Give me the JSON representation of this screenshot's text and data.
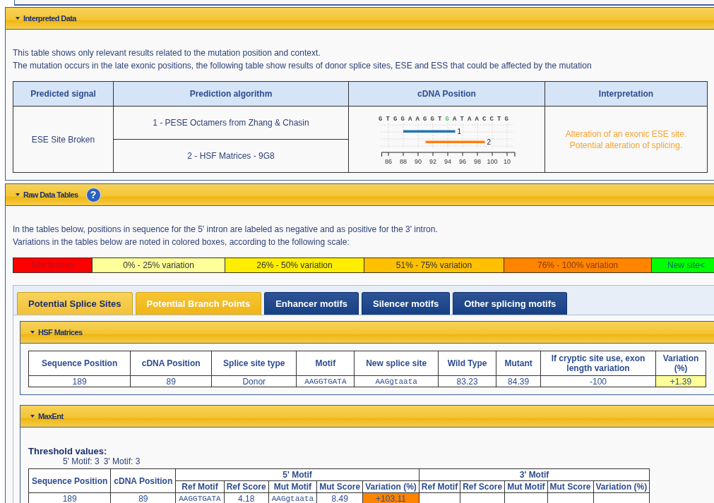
{
  "interpreted": {
    "title": "Interpreted Data",
    "intro": [
      "This table shows only relevant results related to the mutation position and context.",
      "The mutation occurs in the late exonic positions, the following table show results of donor splice sites, ESE and ESS that could be affected by the mutation"
    ],
    "columns": [
      "Predicted signal",
      "Prediction algorithm",
      "cDNA Position",
      "Interpretation"
    ],
    "rows": [
      {
        "signal": "ESE Site Broken",
        "algorithms": [
          "1 - PESE Octamers from Zhang & Chasin",
          "2 - HSF Matrices - 9G8"
        ],
        "sequence": [
          {
            "base": "G",
            "mutated": false
          },
          {
            "base": "T",
            "mutated": false
          },
          {
            "base": "G",
            "mutated": false
          },
          {
            "base": "G",
            "mutated": false
          },
          {
            "base": "A",
            "mutated": false
          },
          {
            "base": "A",
            "mutated": false
          },
          {
            "base": "G",
            "mutated": false
          },
          {
            "base": "G",
            "mutated": false
          },
          {
            "base": "T",
            "mutated": false
          },
          {
            "base": "G",
            "mutated": true
          },
          {
            "base": "A",
            "mutated": false
          },
          {
            "base": "T",
            "mutated": false
          },
          {
            "base": "A",
            "mutated": false
          },
          {
            "base": "A",
            "mutated": false
          },
          {
            "base": "C",
            "mutated": false
          },
          {
            "base": "C",
            "mutated": false
          },
          {
            "base": "T",
            "mutated": false
          },
          {
            "base": "G",
            "mutated": false
          }
        ],
        "ticks": [
          "86",
          "88",
          "90",
          "92",
          "94",
          "96",
          "98",
          "100",
          "10"
        ],
        "tracks": [
          {
            "label": "1",
            "color": "#1f77b4"
          },
          {
            "label": "2",
            "color": "#ff7f0e"
          }
        ],
        "interpretation": [
          "Alteration of an exonic ESE site.",
          "Potential alteration of splicing."
        ]
      }
    ]
  },
  "raw": {
    "title": "Raw Data Tables",
    "help": "?",
    "intro": [
      "In the tables below, positions in sequence for the 5' intron are labeled as negative and as positive for the 3' intron.",
      "Variations in the tables below are noted in colored boxes, according to the following scale:"
    ],
    "scale": [
      {
        "label": "Site broken",
        "color": "#ff0000"
      },
      {
        "label": "0% - 25% variation",
        "color": "#ffff99"
      },
      {
        "label": "26% - 50% variation",
        "color": "#ffee00"
      },
      {
        "label": "51% - 75% variation",
        "color": "#ffc000"
      },
      {
        "label": "76% - 100% variation",
        "color": "#ff8400"
      },
      {
        "label": "New site<",
        "color": "#00ff00"
      }
    ],
    "tabs": [
      {
        "label": "Potential Splice Sites",
        "selected": true,
        "highlighted": false
      },
      {
        "label": "Potential Branch Points",
        "selected": false,
        "highlighted": true
      },
      {
        "label": "Enhancer motifs",
        "selected": false,
        "highlighted": false
      },
      {
        "label": "Silencer motifs",
        "selected": false,
        "highlighted": false
      },
      {
        "label": "Other splicing motifs",
        "selected": false,
        "highlighted": false
      }
    ],
    "hsf": {
      "title": "HSF Matrices",
      "columns": [
        "Sequence Position",
        "cDNA Position",
        "Splice site type",
        "Motif",
        "New splice site",
        "Wild Type",
        "Mutant",
        "If cryptic site use, exon length variation",
        "Variation (%)"
      ],
      "rows": [
        {
          "cells": [
            {
              "value": "189",
              "mono": false
            },
            {
              "value": "89",
              "mono": false
            },
            {
              "value": "Donor",
              "mono": false
            },
            {
              "value": "AAGGTGATA",
              "mono": true
            },
            {
              "value": "AAGgtaata",
              "mono": true
            },
            {
              "value": "83.23",
              "mono": false
            },
            {
              "value": "84.39",
              "mono": false
            },
            {
              "value": "-100",
              "mono": false
            },
            {
              "value": "+1.39",
              "mono": false
            }
          ],
          "color": "#ffff99"
        }
      ]
    },
    "maxent": {
      "title": "MaxEnt",
      "threshold_title": "Threshold values:",
      "thresholds": [
        "5' Motif: 3",
        "3' Motif: 3"
      ],
      "fixed_columns": [
        "Sequence Position",
        "cDNA Position"
      ],
      "groups": [
        {
          "title": "5' Motif",
          "columns": [
            "Ref Motif",
            "Ref Score",
            "Mut Motif",
            "Mut Score",
            "Variation (%)"
          ]
        },
        {
          "title": "3' Motif",
          "columns": [
            "Ref Motif",
            "Ref Score",
            "Mut Motif",
            "Mut Score",
            "Variation (%)"
          ]
        }
      ],
      "rows": [
        {
          "fixed": [
            "189",
            "89"
          ],
          "groups": [
            {
              "cells": [
                {
                  "value": "AAGGTGATA",
                  "mono": true
                },
                {
                  "value": "4.18",
                  "mono": false
                },
                {
                  "value": "AAGgtaata",
                  "mono": true
                },
                {
                  "value": "8.49",
                  "mono": false
                },
                {
                  "value": "+103.11",
                  "mono": false
                }
              ],
              "color": "#ff8400"
            }
          ]
        }
      ]
    }
  }
}
